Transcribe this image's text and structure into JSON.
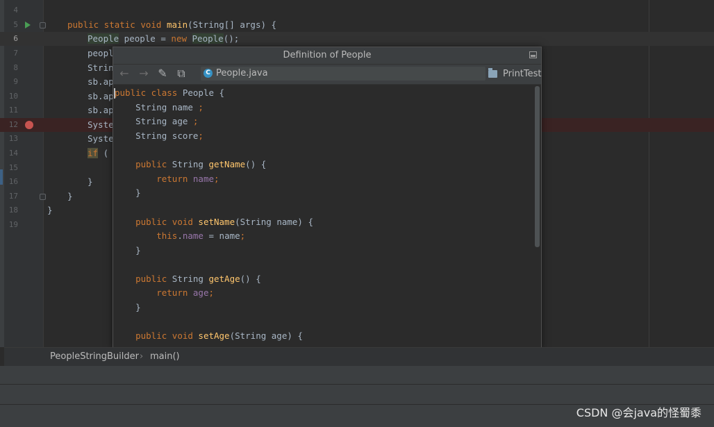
{
  "editor": {
    "line_numbers": [
      "4",
      "5",
      "6",
      "7",
      "8",
      "9",
      "10",
      "11",
      "12",
      "13",
      "14",
      "15",
      "16",
      "17",
      "18",
      "19"
    ],
    "lines": {
      "l5": {
        "kw1": "public static void ",
        "fn": "main",
        "rest": "(String[] args) {"
      },
      "l6": {
        "t1": "People",
        "t2": " people = ",
        "kw": "new ",
        "t3": "People",
        "t4": "();"
      },
      "l7": "peopl",
      "l8": "Strin",
      "l9": "sb.ap",
      "l10": "sb.ap",
      "l11": "sb.ap",
      "l12": "Syste",
      "l13": "Syste",
      "l14": {
        "kw": "if",
        "rest": " ("
      },
      "l16": "}",
      "l17": "}",
      "l18": "}"
    }
  },
  "popup": {
    "title": "Definition of People",
    "file_name": "People.java",
    "file_icon_letter": "C",
    "module_name": "PrintTest",
    "back_icon": "←",
    "forward_icon": "→",
    "edit_icon": "✎",
    "find_icon": "⧉",
    "code": {
      "p1": {
        "kw": "public class ",
        "rest": "People {"
      },
      "p2": {
        "t": "String name ",
        "kw": ";"
      },
      "p3": {
        "t": "String age ",
        "kw": ";"
      },
      "p4": {
        "t": "String score",
        "kw": ";"
      },
      "p6": {
        "kw": "public ",
        "t": "String ",
        "fn": "getName",
        "rest": "() {"
      },
      "p7": {
        "kw": "return ",
        "fld": "name",
        "end": ";"
      },
      "p8": "}",
      "p10": {
        "kw": "public void ",
        "fn": "setName",
        "rest": "(String name) {"
      },
      "p11": {
        "kw": "this",
        "dot": ".",
        "fld": "name",
        "rest": " = name",
        "end": ";"
      },
      "p12": "}",
      "p14": {
        "kw": "public ",
        "t": "String ",
        "fn": "getAge",
        "rest": "() {"
      },
      "p15": {
        "kw": "return ",
        "fld": "age",
        "end": ";"
      },
      "p16": "}",
      "p18": {
        "kw": "public void ",
        "fn": "setAge",
        "rest": "(String age) {"
      }
    }
  },
  "breadcrumb": {
    "items": [
      "PeopleStringBuilder",
      "main()"
    ],
    "separator": "›"
  },
  "watermark": "CSDN @会java的怪蜀黍",
  "colors": {
    "keyword": "#cc7832",
    "function": "#ffc66d",
    "field": "#9876aa",
    "text": "#a9b7c6",
    "background": "#2b2b2b"
  }
}
